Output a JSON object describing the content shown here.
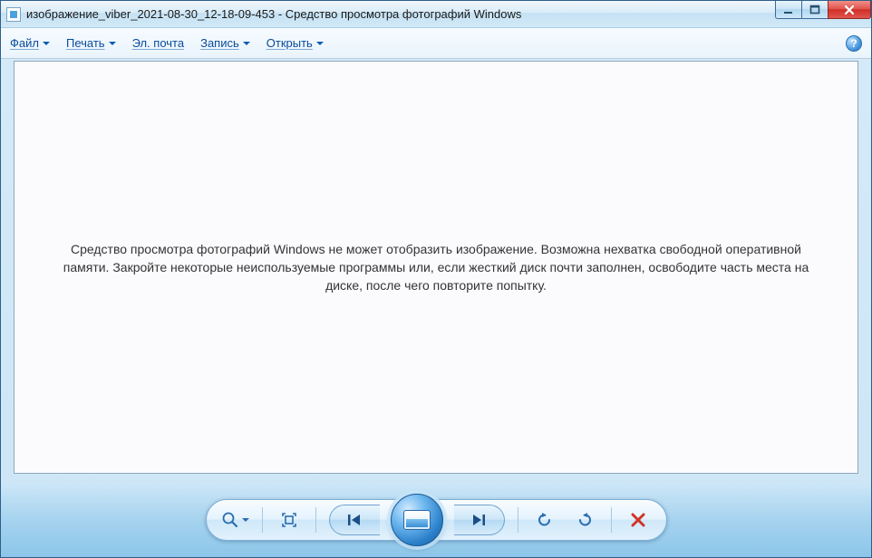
{
  "title": "изображение_viber_2021-08-30_12-18-09-453 - Средство просмотра фотографий Windows",
  "menu": {
    "file": "Файл",
    "print": "Печать",
    "email": "Эл. почта",
    "burn": "Запись",
    "open": "Открыть"
  },
  "error_message": "Средство просмотра фотографий Windows не может отобразить изображение. Возможна нехватка свободной оперативной памяти. Закройте некоторые неиспользуемые программы или, если жесткий диск почти заполнен, освободите часть места на диске, после чего повторите попытку.",
  "help_symbol": "?"
}
